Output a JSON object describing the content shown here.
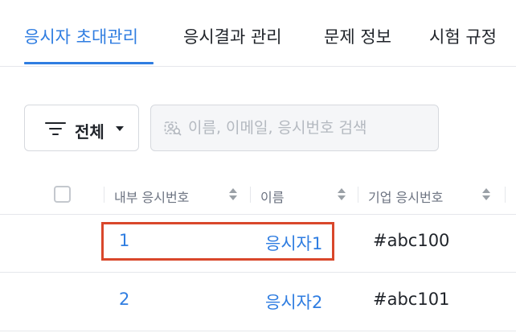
{
  "tabs": [
    {
      "label": "응시자 초대관리",
      "active": true
    },
    {
      "label": "응시결과 관리",
      "active": false
    },
    {
      "label": "문제 정보",
      "active": false
    },
    {
      "label": "시험 규정",
      "active": false
    }
  ],
  "toolbar": {
    "filter_label": "전체",
    "filter_icon": "filter-icon",
    "search_placeholder": "이름, 이메일, 응시번호 검색",
    "search_value": "",
    "search_icon": "user-search-icon"
  },
  "table": {
    "columns": [
      "내부 응시번호",
      "이름",
      "기업 응시번호"
    ],
    "rows": [
      {
        "internal_no": "1",
        "name": "응시자1",
        "company_no": "#abc100"
      },
      {
        "internal_no": "2",
        "name": "응시자2",
        "company_no": "#abc101"
      }
    ]
  },
  "colors": {
    "accent": "#2f7de1",
    "highlight": "#d9472b"
  }
}
